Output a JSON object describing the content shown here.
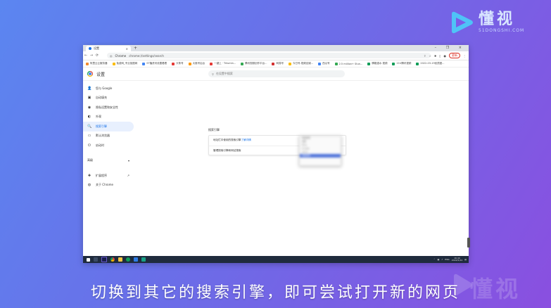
{
  "logo": {
    "cn": "懂视",
    "en": "51DONGSHI.COM"
  },
  "browser": {
    "tab_title": "设置",
    "tab_close": "×",
    "new_tab": "+",
    "window_controls": "– ❐ ×",
    "omnibox": {
      "chip": "Chrome",
      "url": "chrome://settings/search"
    },
    "update_label": "更新",
    "bookmarks": [
      {
        "label": "阿里云云服务器",
        "color": "#f28b30"
      },
      {
        "label": "免费网_专业抠图网",
        "color": "#fbbc05"
      },
      {
        "label": "ST播资讯设置看看",
        "color": "#4285f4"
      },
      {
        "label": "头条号",
        "color": "#e53935"
      },
      {
        "label": "大鱼号后台",
        "color": "#ff9800"
      },
      {
        "label": "一键上 · Trilumin...",
        "color": "#e53935"
      },
      {
        "label": "腾讯视频创作平台...",
        "color": "#34a853"
      },
      {
        "label": "网易号",
        "color": "#d32f2f"
      },
      {
        "label": "今日号-视频自媒...",
        "color": "#fbbc05"
      },
      {
        "label": "西瓜号",
        "color": "#4285f4"
      },
      {
        "label": "2.5 million+ Stun...",
        "color": "#34a853"
      },
      {
        "label": "腾格重水 视频",
        "color": "#0f9d58"
      },
      {
        "label": "21V腾讯视频",
        "color": "#0f9d58"
      },
      {
        "label": "2022-03-19优质团...",
        "color": "#0f9d58"
      }
    ]
  },
  "settings": {
    "title": "设置",
    "search_placeholder": "在设置中搜索",
    "sidebar": [
      {
        "icon": "person-icon",
        "glyph": "👤",
        "label": "您与 Google"
      },
      {
        "icon": "autofill-icon",
        "glyph": "▣",
        "label": "自动填充"
      },
      {
        "icon": "shield-icon",
        "glyph": "◉",
        "label": "隐私设置和安全性"
      },
      {
        "icon": "palette-icon",
        "glyph": "◐",
        "label": "外观"
      },
      {
        "icon": "search-icon",
        "glyph": "🔍",
        "label": "搜索引擎",
        "active": true
      },
      {
        "icon": "browser-icon",
        "glyph": "▭",
        "label": "默认浏览器"
      },
      {
        "icon": "power-icon",
        "glyph": "⏻",
        "label": "启动时"
      }
    ],
    "advanced_label": "高级",
    "advanced_toggle": "▾",
    "extensions_label": "扩展程序",
    "external_link": "↗",
    "about_label": "关于 Chrome",
    "section_title": "搜索引擎",
    "rows": [
      {
        "text": "地址栏中使用的搜索引擎",
        "link": "了解详情"
      },
      {
        "text": "管理搜索引擎和网站搜索"
      }
    ],
    "dropdown": {
      "current": "百度搜索",
      "options": [
        "百度",
        "Bing",
        "Google",
        "Yahoo",
        "百度搜索"
      ]
    }
  },
  "taskbar": {
    "lang": "ENG",
    "time": "16:40",
    "date": "2022/5/24"
  },
  "caption": "切换到其它的搜索引擎，即可尝试打开新的网页",
  "watermark": "懂视"
}
